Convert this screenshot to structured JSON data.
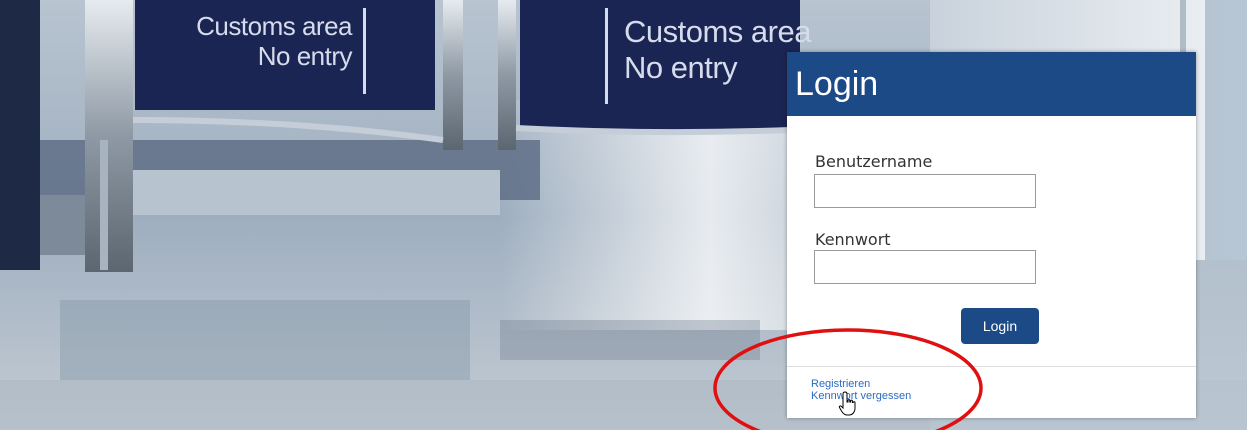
{
  "background": {
    "signs": [
      {
        "line1": "Customs area",
        "line2": "No entry"
      },
      {
        "line1": "Customs area",
        "line2": "No entry"
      }
    ]
  },
  "login": {
    "title": "Login",
    "username_label": "Benutzername",
    "username_value": "",
    "password_label": "Kennwort",
    "password_value": "",
    "submit_label": "Login",
    "links": {
      "register": "Registrieren",
      "forgot_password": "Kennwort vergessen"
    }
  },
  "colors": {
    "brand": "#1c4a86",
    "link": "#2a6bc4",
    "annotation": "#e01010"
  },
  "icons": {
    "cursor": "hand-pointer-icon"
  }
}
